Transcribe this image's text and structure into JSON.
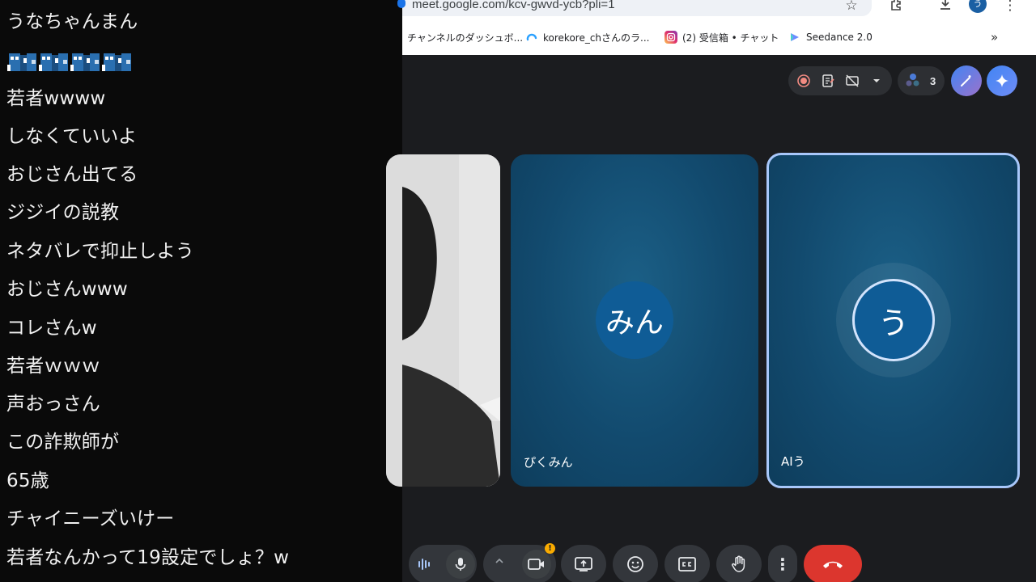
{
  "chat": {
    "lines": [
      "うなちゃんまん",
      "若者wwww",
      "しなくていいよ",
      "おじさん出てる",
      "ジジイの説教",
      "ネタバレで抑止しよう",
      "おじさんwww",
      "コレさんw",
      "若者ｗｗｗ",
      "声おっさん",
      "この詐欺師が",
      "65歳",
      "チャイニーズいけー",
      "若者なんかって19設定でしょ？w"
    ],
    "emotes": [
      "blue-creature-emote",
      "blue-creature-emote",
      "blue-creature-emote",
      "blue-creature-emote"
    ]
  },
  "browser": {
    "url": "meet.google.com/kcv-gwvd-ycb?pli=1",
    "profile_initial": "う",
    "bookmarks": [
      {
        "label": "チャンネルのダッシュボ...",
        "icon": "youtube-studio-icon",
        "color": "#ffffff"
      },
      {
        "label": "korekore_chさんのラ...",
        "icon": "cloud-icon",
        "color": "#2aa0ff"
      },
      {
        "label": "(2) 受信箱 • チャット",
        "icon": "instagram-icon",
        "color": "#d6249f"
      },
      {
        "label": "Seedance 2.0",
        "icon": "seedance-icon",
        "color": "#6b8cff"
      }
    ],
    "more": "»"
  },
  "meet": {
    "participant_count": "3",
    "tiles": [
      {
        "name": "ぴくみん",
        "avatar_text": "みん"
      },
      {
        "name": "AIう",
        "avatar_text": "う"
      }
    ],
    "accent_colors": {
      "tile": "#124a6e",
      "speaking_border": "#a8c7fa",
      "end_call": "#dc362e",
      "warning_badge": "#f9ab00"
    },
    "warning_badge": "!"
  }
}
